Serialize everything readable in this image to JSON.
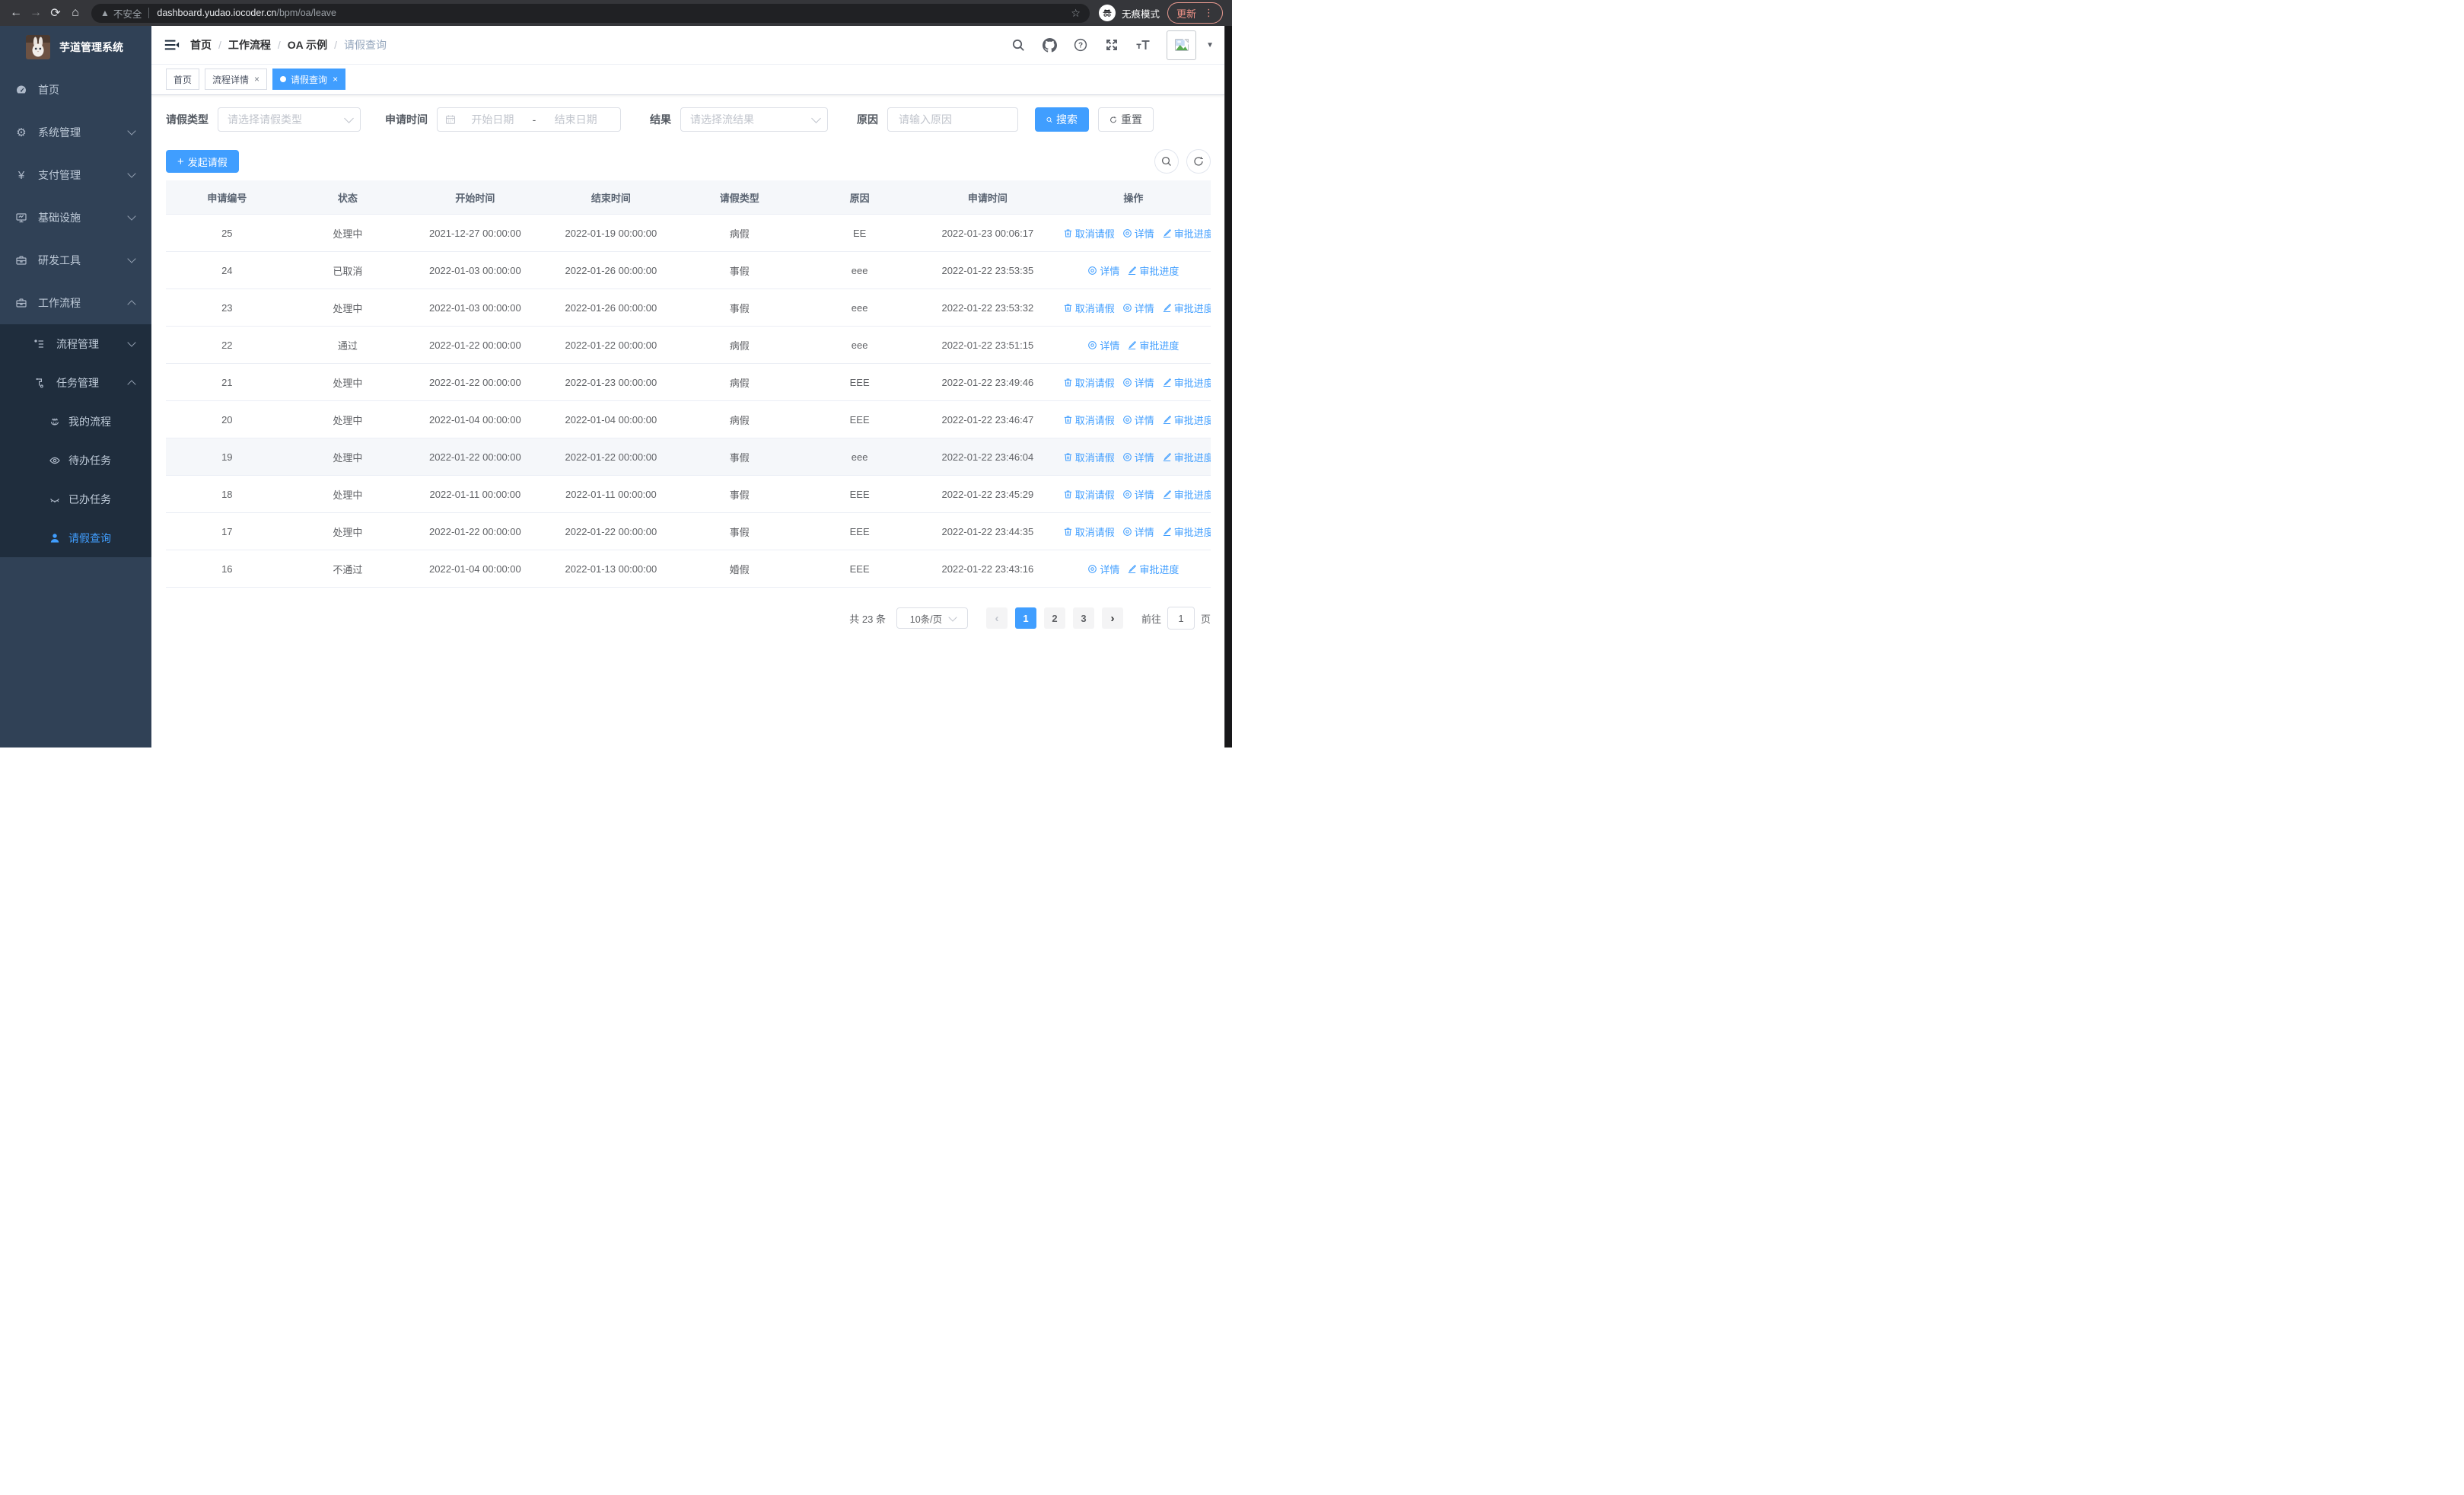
{
  "browser": {
    "security_label": "不安全",
    "url_host": "dashboard.yudao.iocoder.cn",
    "url_path": "/bpm/oa/leave",
    "incognito_label": "无痕模式",
    "update_label": "更新"
  },
  "sidebar": {
    "title": "芋道管理系统",
    "items": [
      {
        "label": "首页",
        "icon": "dashboard-icon",
        "level": 1
      },
      {
        "label": "系统管理",
        "icon": "gear-icon",
        "level": 1,
        "chevron": "down"
      },
      {
        "label": "支付管理",
        "icon": "yen-icon",
        "level": 1,
        "chevron": "down"
      },
      {
        "label": "基础设施",
        "icon": "monitor-icon",
        "level": 1,
        "chevron": "down"
      },
      {
        "label": "研发工具",
        "icon": "toolbox-icon",
        "level": 1,
        "chevron": "down"
      },
      {
        "label": "工作流程",
        "icon": "briefcase-icon",
        "level": 1,
        "chevron": "up"
      },
      {
        "label": "流程管理",
        "icon": "tree-icon",
        "level": 2,
        "chevron": "down"
      },
      {
        "label": "任务管理",
        "icon": "flow-icon",
        "level": 2,
        "chevron": "up"
      },
      {
        "label": "我的流程",
        "icon": "robot-icon",
        "level": 3
      },
      {
        "label": "待办任务",
        "icon": "eye-open-icon",
        "level": 3
      },
      {
        "label": "已办任务",
        "icon": "eye-closed-icon",
        "level": 3
      },
      {
        "label": "请假查询",
        "icon": "user-icon",
        "level": 3,
        "active": true
      }
    ]
  },
  "header": {
    "breadcrumb": [
      "首页",
      "工作流程",
      "OA 示例",
      "请假查询"
    ],
    "separator": "/"
  },
  "tags": [
    {
      "label": "首页",
      "closable": false,
      "active": false
    },
    {
      "label": "流程详情",
      "closable": true,
      "active": false
    },
    {
      "label": "请假查询",
      "closable": true,
      "active": true
    }
  ],
  "filters": {
    "leave_type_label": "请假类型",
    "leave_type_placeholder": "请选择请假类型",
    "apply_time_label": "申请时间",
    "date_start_placeholder": "开始日期",
    "date_separator": "-",
    "date_end_placeholder": "结束日期",
    "result_label": "结果",
    "result_placeholder": "请选择流结果",
    "reason_label": "原因",
    "reason_placeholder": "请输入原因",
    "search_label": "搜索",
    "reset_label": "重置"
  },
  "toolbar": {
    "create_label": "发起请假"
  },
  "table": {
    "columns": [
      "申请编号",
      "状态",
      "开始时间",
      "结束时间",
      "请假类型",
      "原因",
      "申请时间",
      "操作"
    ],
    "action_labels": {
      "cancel": "取消请假",
      "detail": "详情",
      "progress": "审批进度"
    },
    "rows": [
      {
        "id": "25",
        "status": "处理中",
        "start": "2021-12-27 00:00:00",
        "end": "2022-01-19 00:00:00",
        "type": "病假",
        "reason": "EE",
        "applied": "2022-01-23 00:06:17",
        "actions": [
          "cancel",
          "detail",
          "progress"
        ],
        "highlight": false
      },
      {
        "id": "24",
        "status": "已取消",
        "start": "2022-01-03 00:00:00",
        "end": "2022-01-26 00:00:00",
        "type": "事假",
        "reason": "eee",
        "applied": "2022-01-22 23:53:35",
        "actions": [
          "detail",
          "progress"
        ],
        "highlight": false
      },
      {
        "id": "23",
        "status": "处理中",
        "start": "2022-01-03 00:00:00",
        "end": "2022-01-26 00:00:00",
        "type": "事假",
        "reason": "eee",
        "applied": "2022-01-22 23:53:32",
        "actions": [
          "cancel",
          "detail",
          "progress"
        ],
        "highlight": false
      },
      {
        "id": "22",
        "status": "通过",
        "start": "2022-01-22 00:00:00",
        "end": "2022-01-22 00:00:00",
        "type": "病假",
        "reason": "eee",
        "applied": "2022-01-22 23:51:15",
        "actions": [
          "detail",
          "progress"
        ],
        "highlight": false
      },
      {
        "id": "21",
        "status": "处理中",
        "start": "2022-01-22 00:00:00",
        "end": "2022-01-23 00:00:00",
        "type": "病假",
        "reason": "EEE",
        "applied": "2022-01-22 23:49:46",
        "actions": [
          "cancel",
          "detail",
          "progress"
        ],
        "highlight": false
      },
      {
        "id": "20",
        "status": "处理中",
        "start": "2022-01-04 00:00:00",
        "end": "2022-01-04 00:00:00",
        "type": "病假",
        "reason": "EEE",
        "applied": "2022-01-22 23:46:47",
        "actions": [
          "cancel",
          "detail",
          "progress"
        ],
        "highlight": false
      },
      {
        "id": "19",
        "status": "处理中",
        "start": "2022-01-22 00:00:00",
        "end": "2022-01-22 00:00:00",
        "type": "事假",
        "reason": "eee",
        "applied": "2022-01-22 23:46:04",
        "actions": [
          "cancel",
          "detail",
          "progress"
        ],
        "highlight": true
      },
      {
        "id": "18",
        "status": "处理中",
        "start": "2022-01-11 00:00:00",
        "end": "2022-01-11 00:00:00",
        "type": "事假",
        "reason": "EEE",
        "applied": "2022-01-22 23:45:29",
        "actions": [
          "cancel",
          "detail",
          "progress"
        ],
        "highlight": false
      },
      {
        "id": "17",
        "status": "处理中",
        "start": "2022-01-22 00:00:00",
        "end": "2022-01-22 00:00:00",
        "type": "事假",
        "reason": "EEE",
        "applied": "2022-01-22 23:44:35",
        "actions": [
          "cancel",
          "detail",
          "progress"
        ],
        "highlight": false
      },
      {
        "id": "16",
        "status": "不通过",
        "start": "2022-01-04 00:00:00",
        "end": "2022-01-13 00:00:00",
        "type": "婚假",
        "reason": "EEE",
        "applied": "2022-01-22 23:43:16",
        "actions": [
          "detail",
          "progress"
        ],
        "highlight": false
      }
    ]
  },
  "pagination": {
    "total_label": "共 23 条",
    "page_size_label": "10条/页",
    "pages": [
      "1",
      "2",
      "3"
    ],
    "active_page": "1",
    "goto_label": "前往",
    "goto_value": "1",
    "page_suffix": "页"
  },
  "colors": {
    "primary": "#409eff",
    "sidebar_bg": "#304156",
    "submenu_bg": "#1f2d3d",
    "chrome_bg": "#35363a",
    "update_accent": "#ef9287"
  }
}
